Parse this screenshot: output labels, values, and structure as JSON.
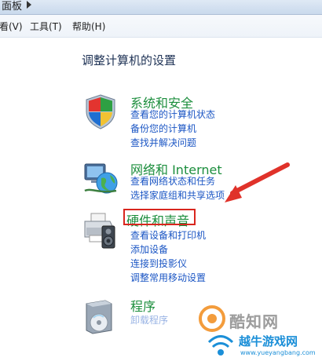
{
  "breadcrumb": {
    "label": "面板"
  },
  "menu": {
    "items": [
      {
        "label": "看(V)"
      },
      {
        "label": "工具(T)"
      },
      {
        "label": "帮助(H)"
      }
    ]
  },
  "page": {
    "title": "调整计算机的设置"
  },
  "categories": [
    {
      "title": "系统和安全",
      "icon": "shield-icon",
      "links": [
        "查看您的计算机状态",
        "备份您的计算机",
        "查找并解决问题"
      ]
    },
    {
      "title": "网络和 Internet",
      "icon": "network-globe-icon",
      "links": [
        "查看网络状态和任务",
        "选择家庭组和共享选项"
      ]
    },
    {
      "title": "硬件和声音",
      "icon": "printer-speaker-icon",
      "links": [
        "查看设备和打印机",
        "添加设备",
        "连接到投影仪",
        "调整常用移动设置"
      ]
    },
    {
      "title": "程序",
      "icon": "programs-disc-icon",
      "links": [
        "卸载程序"
      ]
    }
  ],
  "annotation": {
    "highlight_color": "#d9261e"
  },
  "watermarks": {
    "primary": "酷知网",
    "secondary": "越牛游戏网",
    "url": "www.yueyangbang.com"
  }
}
